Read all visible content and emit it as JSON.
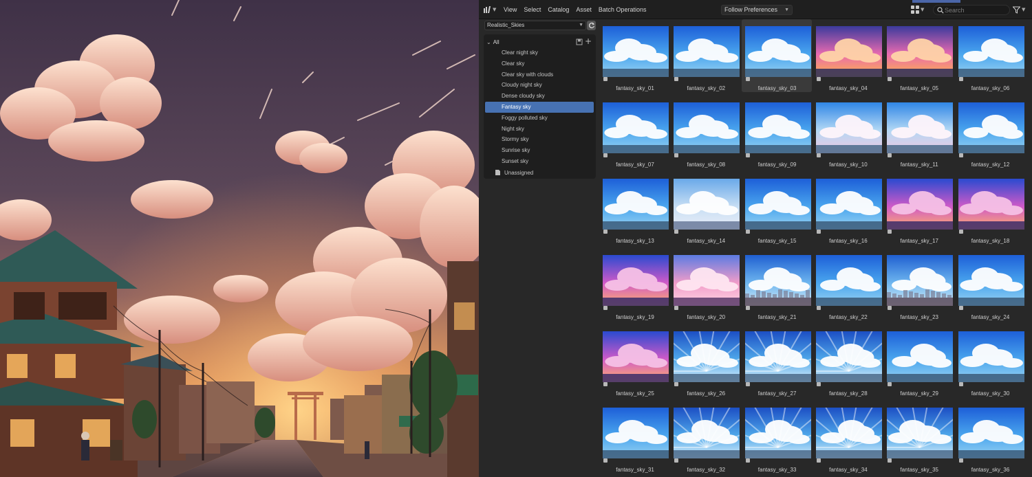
{
  "header": {
    "editor_icon": "asset-browser-icon",
    "menus": [
      "View",
      "Select",
      "Catalog",
      "Asset",
      "Batch Operations"
    ],
    "import_method": "Follow Preferences",
    "search_placeholder": "Search",
    "display_icon": "grid-icon",
    "filter_icon": "filter-icon"
  },
  "library": {
    "selected": "Realistic_Skies",
    "refresh_icon": "refresh-icon"
  },
  "catalogs": {
    "root_label": "All",
    "items": [
      "Clear night sky",
      "Clear sky",
      "Clear sky with clouds",
      "Cloudy night sky",
      "Dense cloudy sky",
      "Fantasy sky",
      "Foggy polluted sky",
      "Night sky",
      "Stormy sky",
      "Sunrise sky",
      "Sunset sky"
    ],
    "selected_index": 5,
    "unassigned_label": "Unassigned"
  },
  "assets": [
    {
      "name": "fantasy_sky_01",
      "palette": "day"
    },
    {
      "name": "fantasy_sky_02",
      "palette": "day"
    },
    {
      "name": "fantasy_sky_03",
      "palette": "day"
    },
    {
      "name": "fantasy_sky_04",
      "palette": "sunset"
    },
    {
      "name": "fantasy_sky_05",
      "palette": "sunset"
    },
    {
      "name": "fantasy_sky_06",
      "palette": "day"
    },
    {
      "name": "fantasy_sky_07",
      "palette": "day"
    },
    {
      "name": "fantasy_sky_08",
      "palette": "day"
    },
    {
      "name": "fantasy_sky_09",
      "palette": "day"
    },
    {
      "name": "fantasy_sky_10",
      "palette": "pastel"
    },
    {
      "name": "fantasy_sky_11",
      "palette": "pastel"
    },
    {
      "name": "fantasy_sky_12",
      "palette": "day"
    },
    {
      "name": "fantasy_sky_13",
      "palette": "day"
    },
    {
      "name": "fantasy_sky_14",
      "palette": "soft"
    },
    {
      "name": "fantasy_sky_15",
      "palette": "day"
    },
    {
      "name": "fantasy_sky_16",
      "palette": "day"
    },
    {
      "name": "fantasy_sky_17",
      "palette": "magic"
    },
    {
      "name": "fantasy_sky_18",
      "palette": "magic"
    },
    {
      "name": "fantasy_sky_19",
      "palette": "magic"
    },
    {
      "name": "fantasy_sky_20",
      "palette": "pink"
    },
    {
      "name": "fantasy_sky_21",
      "palette": "city"
    },
    {
      "name": "fantasy_sky_22",
      "palette": "day"
    },
    {
      "name": "fantasy_sky_23",
      "palette": "city"
    },
    {
      "name": "fantasy_sky_24",
      "palette": "day"
    },
    {
      "name": "fantasy_sky_25",
      "palette": "magic"
    },
    {
      "name": "fantasy_sky_26",
      "palette": "burst"
    },
    {
      "name": "fantasy_sky_27",
      "palette": "burst"
    },
    {
      "name": "fantasy_sky_28",
      "palette": "burst"
    },
    {
      "name": "fantasy_sky_29",
      "palette": "day"
    },
    {
      "name": "fantasy_sky_30",
      "palette": "day"
    },
    {
      "name": "fantasy_sky_31",
      "palette": "day"
    },
    {
      "name": "fantasy_sky_32",
      "palette": "burst"
    },
    {
      "name": "fantasy_sky_33",
      "palette": "burst"
    },
    {
      "name": "fantasy_sky_34",
      "palette": "burst"
    },
    {
      "name": "fantasy_sky_35",
      "palette": "burst"
    },
    {
      "name": "fantasy_sky_36",
      "palette": "day"
    }
  ],
  "hovered_index": 2,
  "colors": {
    "accent": "#4772b3",
    "panel": "#282828",
    "header": "#1f1f1f",
    "text": "#d0d0d0"
  }
}
